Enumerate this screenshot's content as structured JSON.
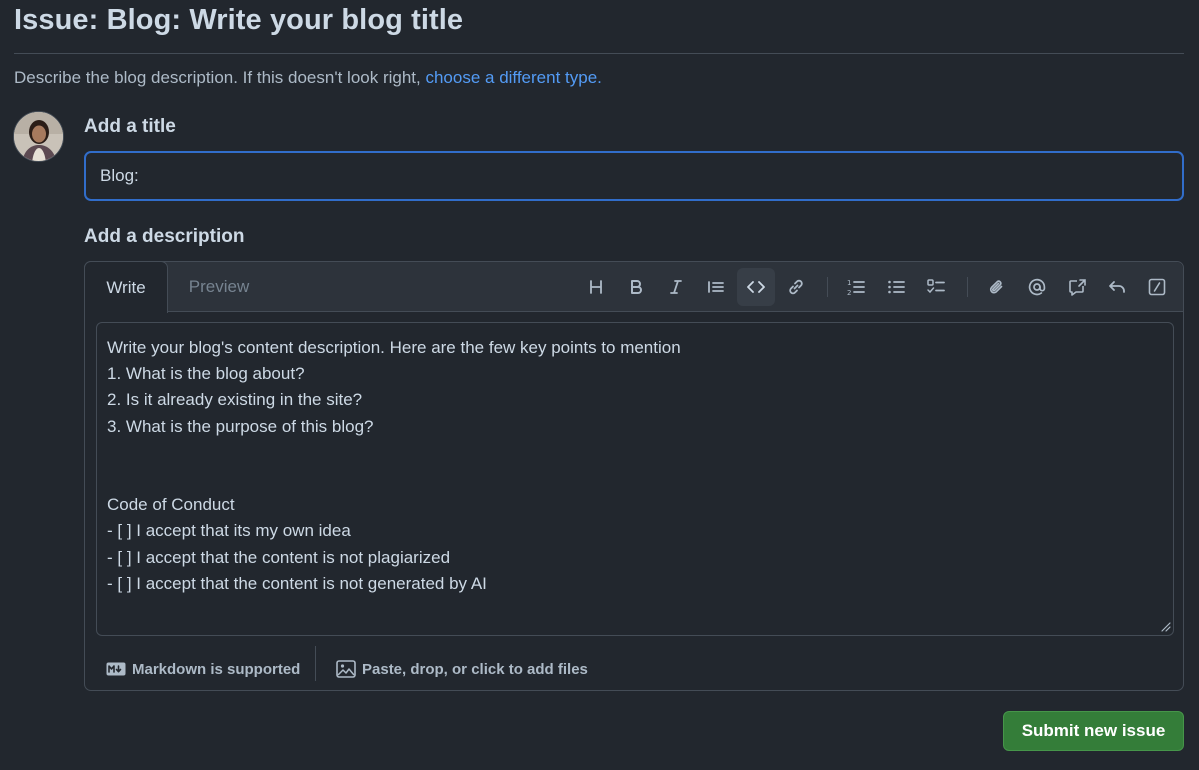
{
  "page": {
    "title": "Issue: Blog: Write your blog title",
    "intro_text": "Describe the blog description. If this doesn't look right, ",
    "intro_link": "choose a different type."
  },
  "title_field": {
    "label": "Add a title",
    "value": "Blog:"
  },
  "description": {
    "label": "Add a description",
    "tabs": [
      "Write",
      "Preview"
    ],
    "active_tab": "Write",
    "toolbar": [
      "heading-icon",
      "bold-icon",
      "italic-icon",
      "quote-icon",
      "code-icon",
      "link-icon",
      "numbered-list-icon",
      "unordered-list-icon",
      "task-list-icon",
      "attach-icon",
      "mention-icon",
      "reference-icon",
      "reply-icon",
      "slash-commands-icon"
    ],
    "body": "Write your blog's content description. Here are the few key points to mention\n1. What is the blog about?\n2. Is it already existing in the site?\n3. What is the purpose of this blog?\n\n\nCode of Conduct\n- [ ] I accept that its my own idea\n- [ ] I accept that the content is not plagiarized\n- [ ] I accept that the content is not generated by AI",
    "markdown_note": "Markdown is supported",
    "files_note": "Paste, drop, or click to add files"
  },
  "submit": {
    "label": "Submit new issue"
  },
  "colors": {
    "background": "#22272e",
    "accent_blue": "#539bf5",
    "submit_green": "#347d39"
  }
}
